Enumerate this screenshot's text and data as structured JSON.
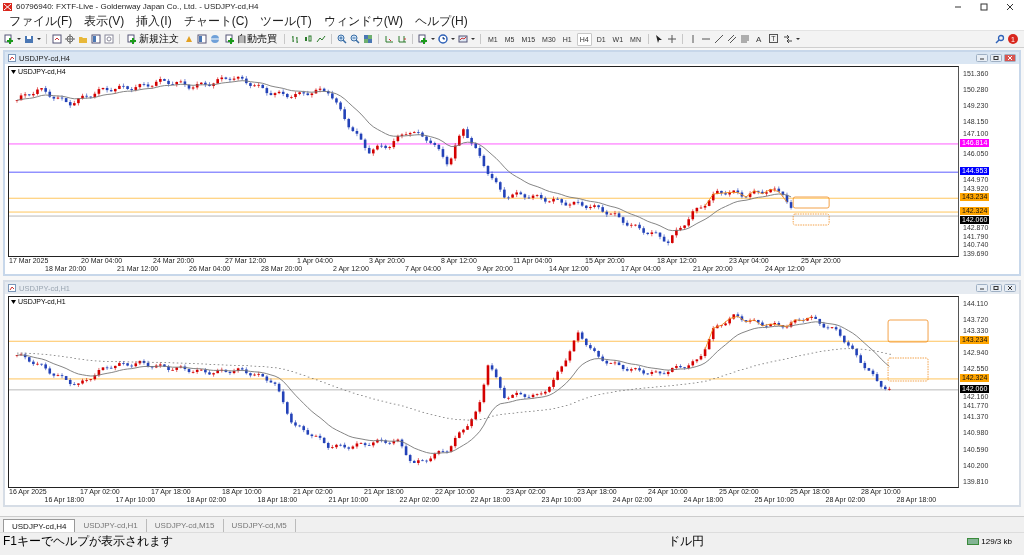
{
  "window": {
    "title": "60796940: FXTF-Live - Goldenway Japan Co., Ltd. - USDJPY-cd,H4"
  },
  "menu": [
    "ファイル(F)",
    "表示(V)",
    "挿入(I)",
    "チャート(C)",
    "ツール(T)",
    "ウィンドウ(W)",
    "ヘルプ(H)"
  ],
  "toolbar": {
    "new_order": "新規注文",
    "auto_trading": "自動売買",
    "text_tool": "A",
    "label_tool": "T",
    "notification_count": "1",
    "timeframes": [
      {
        "label": "M1",
        "selected": false
      },
      {
        "label": "M5",
        "selected": false
      },
      {
        "label": "M15",
        "selected": false
      },
      {
        "label": "M30",
        "selected": false
      },
      {
        "label": "H1",
        "selected": false
      },
      {
        "label": "H4",
        "selected": true
      },
      {
        "label": "D1",
        "selected": false
      },
      {
        "label": "W1",
        "selected": false
      },
      {
        "label": "MN",
        "selected": false
      }
    ]
  },
  "charts": [
    {
      "title": "USDJPY-cd,H4",
      "active": true,
      "label": "USDJPY-cd,H4",
      "price_ticks": [
        "151.360",
        "150.280",
        "149.230",
        "148.150",
        "147.100",
        "146.050",
        "144.970",
        "143.920",
        "142.870",
        "141.790",
        "140.740",
        "139.690"
      ],
      "price_tags": [
        {
          "label": "146.814",
          "color": "#ff00ff"
        },
        {
          "label": "144.953",
          "color": "#0000ff"
        },
        {
          "label": "143.234",
          "color": "#ffa500"
        },
        {
          "label": "142.324",
          "color": "#ffa500"
        },
        {
          "label": "142.060",
          "color": "#000000"
        }
      ],
      "time_labels": [
        "17 Mar 2025",
        "18 Mar 20:00",
        "20 Mar 04:00",
        "21 Mar 12:00",
        "24 Mar 20:00",
        "26 Mar 04:00",
        "27 Mar 12:00",
        "28 Mar 20:00",
        "1 Apr 04:00",
        "2 Apr 12:00",
        "3 Apr 20:00",
        "7 Apr 04:00",
        "8 Apr 12:00",
        "9 Apr 20:00",
        "11 Apr 04:00",
        "14 Apr 12:00",
        "15 Apr 20:00",
        "17 Apr 04:00",
        "18 Apr 12:00",
        "21 Apr 20:00",
        "23 Apr 04:00",
        "24 Apr 12:00",
        "25 Apr 20:00"
      ]
    },
    {
      "title": "USDJPY-cd,H1",
      "active": false,
      "label": "USDJPY-cd,H1",
      "price_ticks": [
        "144.110",
        "143.720",
        "143.330",
        "142.940",
        "142.550",
        "142.160",
        "141.770",
        "141.370",
        "140.980",
        "140.590",
        "140.200",
        "139.810"
      ],
      "price_tags": [
        {
          "label": "143.234",
          "color": "#ffa500"
        },
        {
          "label": "142.324",
          "color": "#ffa500"
        },
        {
          "label": "142.060",
          "color": "#000000"
        }
      ],
      "time_labels": [
        "16 Apr 2025",
        "16 Apr 18:00",
        "17 Apr 02:00",
        "17 Apr 10:00",
        "17 Apr 18:00",
        "18 Apr 02:00",
        "18 Apr 10:00",
        "18 Apr 18:00",
        "21 Apr 02:00",
        "21 Apr 10:00",
        "21 Apr 18:00",
        "22 Apr 02:00",
        "22 Apr 10:00",
        "22 Apr 18:00",
        "23 Apr 02:00",
        "23 Apr 10:00",
        "23 Apr 18:00",
        "24 Apr 02:00",
        "24 Apr 10:00",
        "24 Apr 18:00",
        "25 Apr 02:00",
        "25 Apr 10:00",
        "25 Apr 18:00",
        "28 Apr 02:00",
        "28 Apr 10:00",
        "28 Apr 18:00"
      ]
    }
  ],
  "tabs": [
    {
      "label": "USDJPY-cd,H4",
      "selected": true
    },
    {
      "label": "USDJPY-cd,H1",
      "selected": false
    },
    {
      "label": "USDJPY-cd,M15",
      "selected": false
    },
    {
      "label": "USDJPY-cd,M5",
      "selected": false
    }
  ],
  "status_bar": {
    "help": "F1キーでヘルプが表示されます",
    "symbol": "ドル円",
    "traffic": "129/3 kb"
  }
}
